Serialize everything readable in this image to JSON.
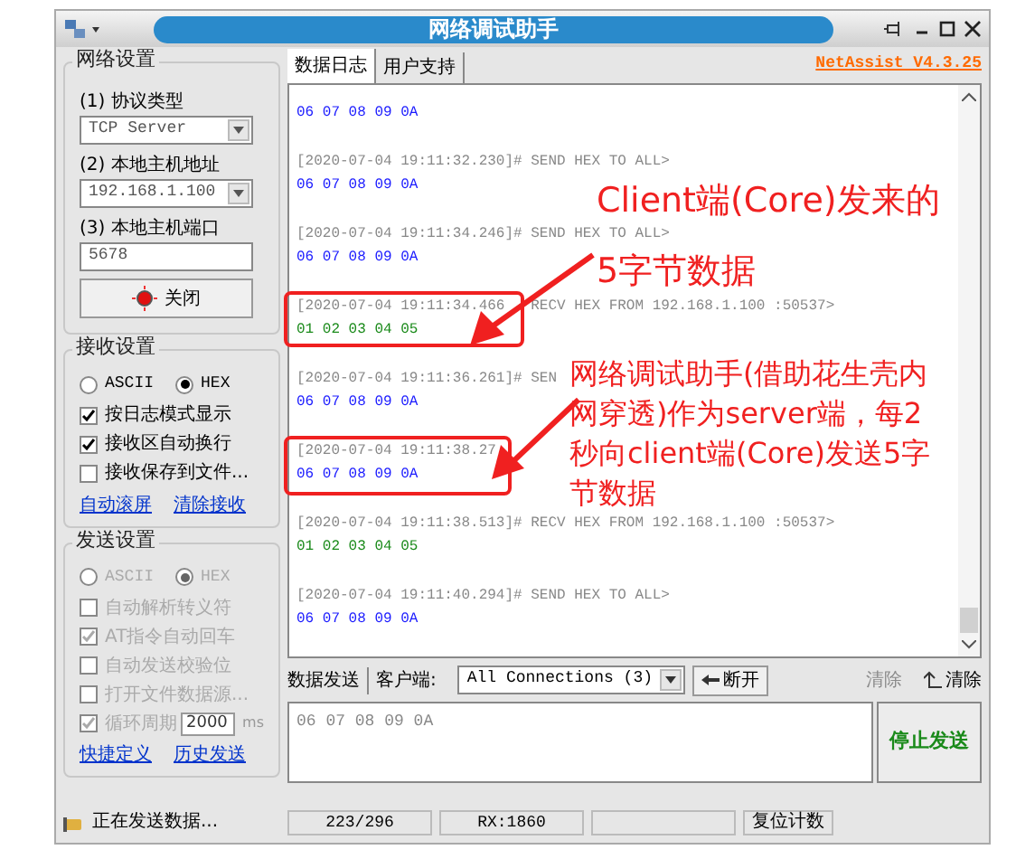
{
  "window": {
    "title": "网络调试助手"
  },
  "network_settings": {
    "title": "网络设置",
    "protocol_label": "(1) 协议类型",
    "protocol": "TCP Server",
    "host_label": "(2) 本地主机地址",
    "host": "192.168.1.100",
    "port_label": "(3) 本地主机端口",
    "port": "5678",
    "close_button": "关闭"
  },
  "receive_settings": {
    "title": "接收设置",
    "modes": [
      {
        "label": "ASCII",
        "selected": false
      },
      {
        "label": "HEX",
        "selected": true
      }
    ],
    "options": [
      {
        "label": "按日志模式显示",
        "checked": true
      },
      {
        "label": "接收区自动换行",
        "checked": true
      },
      {
        "label": "接收保存到文件...",
        "checked": false
      }
    ],
    "links": [
      "自动滚屏",
      "清除接收"
    ]
  },
  "send_settings": {
    "title": "发送设置",
    "disabled": true,
    "modes": [
      {
        "label": "ASCII",
        "selected": false
      },
      {
        "label": "HEX",
        "selected": true
      }
    ],
    "options": [
      {
        "label": "自动解析转义符",
        "checked": false
      },
      {
        "label": "AT指令自动回车",
        "checked": true
      },
      {
        "label": "自动发送校验位",
        "checked": false
      },
      {
        "label": "打开文件数据源...",
        "checked": false
      },
      {
        "label": "循环周期",
        "checked": true
      }
    ],
    "period": "2000",
    "period_unit": "ms",
    "links": [
      "快捷定义",
      "历史发送"
    ]
  },
  "left_status": "正在发送数据...",
  "tabs": [
    {
      "label": "数据日志",
      "selected": true
    },
    {
      "label": "用户支持",
      "selected": false
    }
  ],
  "version": "NetAssist V4.3.25",
  "log": [
    {
      "kind": "send",
      "data": "06 07 08 09 0A"
    },
    {
      "kind": "send",
      "time": "[2020-07-04 19:11:32.230]#",
      "info": "SEND HEX TO ALL>",
      "data": "06 07 08 09 0A"
    },
    {
      "kind": "send",
      "time": "[2020-07-04 19:11:34.246]#",
      "info": "SEND HEX TO ALL>",
      "data": "06 07 08 09 0A"
    },
    {
      "kind": "recv",
      "time": "[2020-07-04 19:11:34.466",
      "info": "RECV HEX FROM 192.168.1.100 :50537>",
      "data": "01 02 03 04 05"
    },
    {
      "kind": "send",
      "time": "[2020-07-04 19:11:36.261]#",
      "info": "SEN",
      "data": "06 07 08 09 0A"
    },
    {
      "kind": "send",
      "time": "[2020-07-04 19:11:38.27",
      "data": "06 07 08 09 0A"
    },
    {
      "kind": "recv",
      "time": "[2020-07-04 19:11:38.513]#",
      "info": "RECV HEX FROM 192.168.1.100 :50537>",
      "data": "01 02 03 04 05"
    },
    {
      "kind": "send",
      "time": "[2020-07-04 19:11:40.294]#",
      "info": "SEND HEX TO ALL>",
      "data": "06 07 08 09 0A"
    }
  ],
  "send_bar": {
    "tab": "数据发送",
    "client_label": "客户端:",
    "client": "All Connections (3)",
    "disconnect": "断开",
    "clear_disabled": "清除",
    "clear": "清除"
  },
  "send_text": "06 07 08 09 0A",
  "stop_button": "停止发送",
  "status_bar": [
    "223/296",
    "RX:1860"
  ],
  "reset_button": "复位计数",
  "annotations": [
    {
      "lines": [
        "Client端(Core)发来的",
        "5字节数据"
      ]
    },
    {
      "lines": [
        "网络调试助手(借助花生壳内",
        "网穿透)作为server端，每2",
        "秒向client端(Core)发送5字",
        "节数据"
      ]
    }
  ]
}
